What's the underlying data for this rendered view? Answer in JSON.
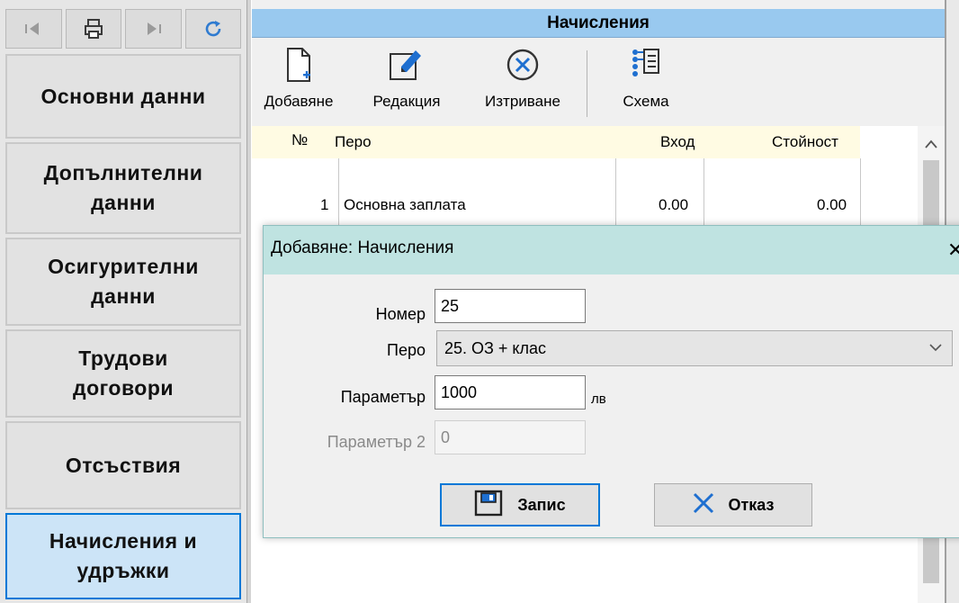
{
  "sidebar": {
    "toolbar_icons": [
      "first-record-icon",
      "print-icon",
      "last-record-icon",
      "refresh-icon"
    ],
    "items": [
      {
        "label": "Основни данни",
        "active": false
      },
      {
        "label": "Допълнителни данни",
        "active": false
      },
      {
        "label": "Осигурителни данни",
        "active": false
      },
      {
        "label": "Трудови договори",
        "active": false
      },
      {
        "label": "Отсъствия",
        "active": false
      },
      {
        "label": "Начисления и удръжки",
        "active": true
      }
    ]
  },
  "main": {
    "title": "Начисления",
    "toolbar": {
      "add_label": "Добавяне",
      "edit_label": "Редакция",
      "delete_label": "Изтриване",
      "scheme_label": "Схема"
    },
    "grid": {
      "columns": [
        "№",
        "Перо",
        "Вход",
        "Стойност"
      ],
      "rows": [
        {
          "no": "1",
          "item": "Основна заплата",
          "input": "0.00",
          "value": "0.00"
        }
      ]
    }
  },
  "dialog": {
    "title": "Добавяне: Начисления",
    "close_glyph": "✕",
    "number_label": "Номер",
    "number_value": "25",
    "item_label": "Перо",
    "item_value": "25. ОЗ + клас",
    "param_label": "Параметър",
    "param_value": "1000",
    "param_unit": "лв",
    "param2_label": "Параметър 2",
    "param2_value": "0",
    "save_label": "Запис",
    "cancel_label": "Отказ"
  },
  "colors": {
    "accent": "#0078d7",
    "title_bar": "#99c9ef",
    "dialog_title_bar": "#bfe3e1",
    "active_nav": "#cce4f7",
    "grid_header": "#fffbe3"
  }
}
